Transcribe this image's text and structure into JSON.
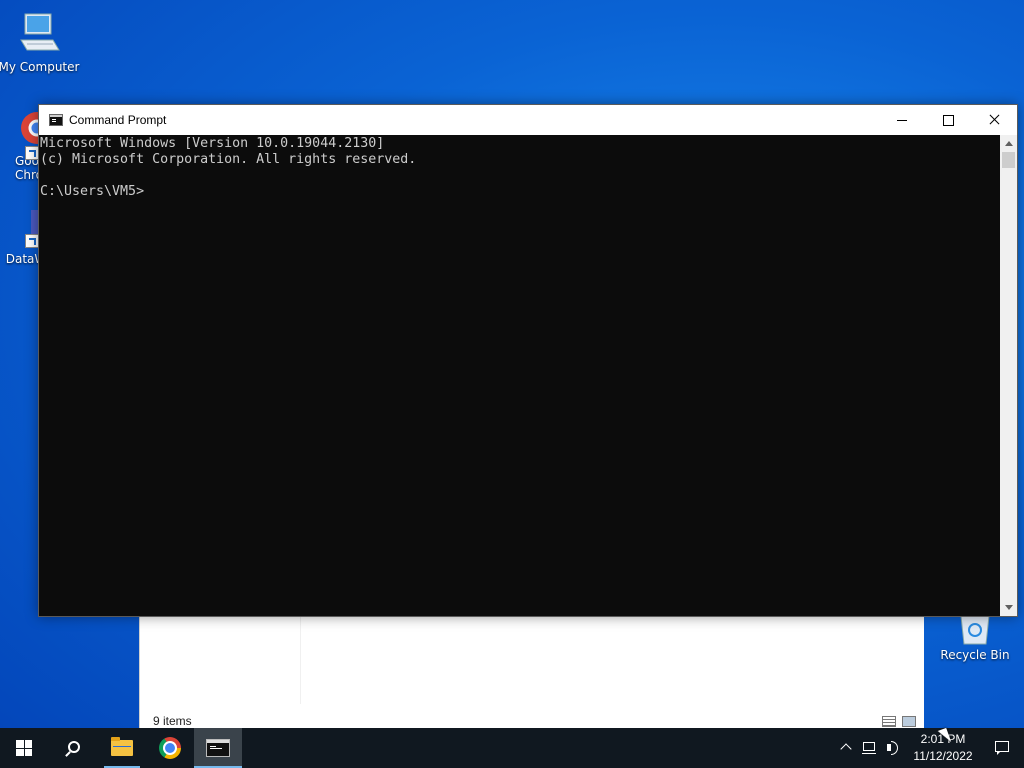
{
  "desktop": {
    "icons": [
      {
        "label": "My Computer",
        "icon": "computer-icon"
      },
      {
        "label": "Goo\nChro",
        "icon": "chrome-icon"
      },
      {
        "label": "DataW",
        "icon": "datawrapper-icon"
      },
      {
        "label": "Recycle Bin",
        "icon": "recycle-bin-icon"
      }
    ]
  },
  "explorer_background": {
    "status_text": "9 items"
  },
  "cmd_window": {
    "title": "Command Prompt",
    "console_lines": [
      "Microsoft Windows [Version 10.0.19044.2130]",
      "(c) Microsoft Corporation. All rights reserved.",
      "",
      "C:\\Users\\VM5>"
    ],
    "background_color": "#0c0c0c",
    "text_color": "#cccccc"
  },
  "taskbar": {
    "apps": [
      {
        "name": "Start",
        "icon": "windows-logo-icon"
      },
      {
        "name": "Search",
        "icon": "search-icon"
      },
      {
        "name": "File Explorer",
        "icon": "folder-icon"
      },
      {
        "name": "Google Chrome",
        "icon": "chrome-icon"
      },
      {
        "name": "Command Prompt",
        "icon": "cmd-icon",
        "active": true
      }
    ],
    "clock": {
      "time": "2:01 PM",
      "date": "11/12/2022"
    },
    "accent_color": "#76b9ed"
  }
}
